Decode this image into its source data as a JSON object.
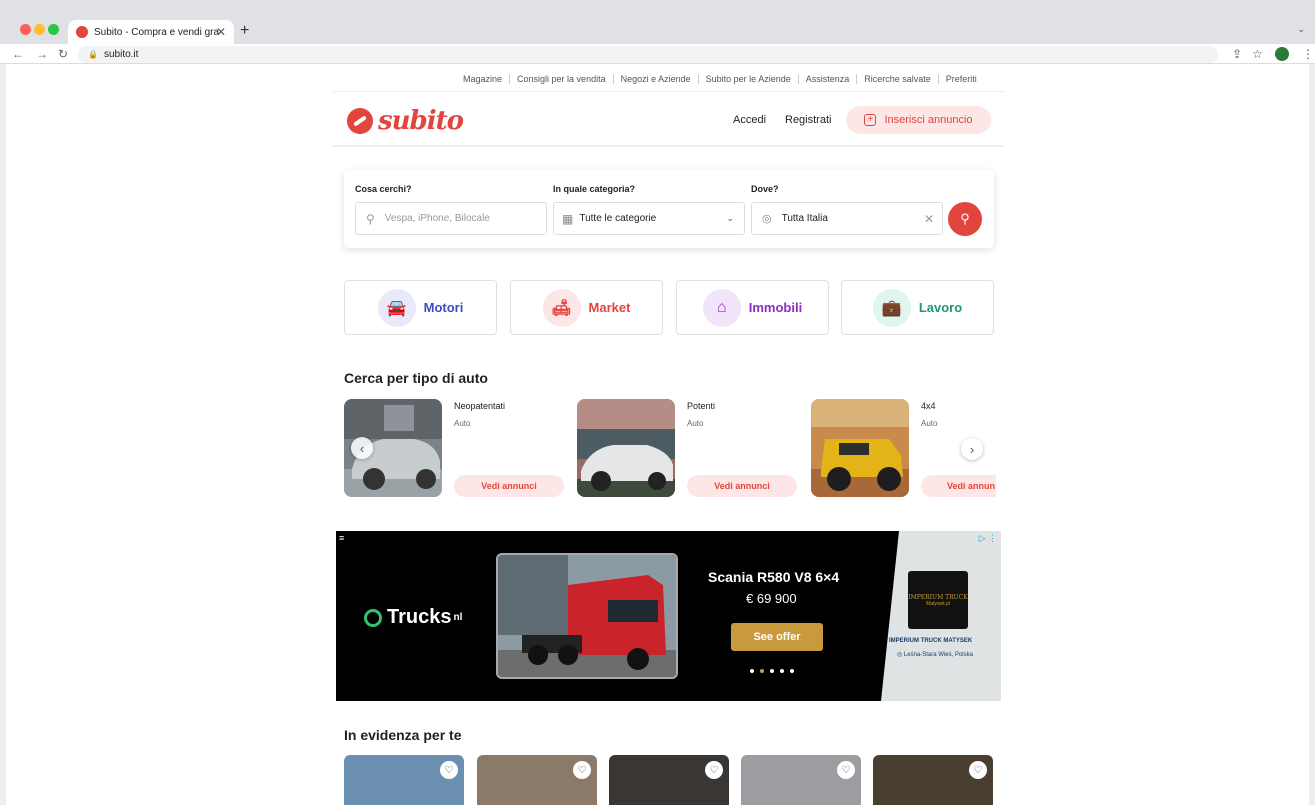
{
  "browser": {
    "tab_title": "Subito - Compra e vendi gra",
    "url": "subito.it"
  },
  "top_links": [
    "Magazine",
    "Consigli per la vendita",
    "Negozi e Aziende",
    "Subito per le Aziende",
    "Assistenza",
    "Ricerche salvate",
    "Preferiti"
  ],
  "header": {
    "logo": "subito",
    "login": "Accedi",
    "register": "Registrati",
    "insert": "Inserisci annuncio"
  },
  "search": {
    "what_label": "Cosa cerchi?",
    "what_placeholder": "Vespa, iPhone, Bilocale",
    "category_label": "In quale categoria?",
    "category_value": "Tutte le categorie",
    "where_label": "Dove?",
    "where_value": "Tutta Italia"
  },
  "categories": [
    {
      "label": "Motori",
      "color": "#3c4cc4",
      "bg": "#e8eafb"
    },
    {
      "label": "Market",
      "color": "#e2453d",
      "bg": "#fde7e6"
    },
    {
      "label": "Immobili",
      "color": "#8e2bc4",
      "bg": "#f2e5fb"
    },
    {
      "label": "Lavoro",
      "color": "#1a9a7a",
      "bg": "#e0f5ef"
    }
  ],
  "car_section": {
    "title": "Cerca per tipo di auto",
    "items": [
      {
        "title": "Neopatentati",
        "subtitle": "Auto",
        "cta": "Vedi annunci"
      },
      {
        "title": "Potenti",
        "subtitle": "Auto",
        "cta": "Vedi annunci"
      },
      {
        "title": "4x4",
        "subtitle": "Auto",
        "cta": "Vedi annun"
      }
    ]
  },
  "ad": {
    "brand": "Trucks",
    "brand_sup": "nl",
    "headline": "Scania R580 V8 6×4",
    "price": "€ 69 900",
    "cta": "See offer",
    "dealer_logo": "IMPERIUM TRUCK",
    "dealer_logo_sub": "Matysek.pl",
    "dealer_name": "IMPERIUM TRUCK MATYSEK",
    "dealer_location": "Leśna-Stara Wieś, Polska"
  },
  "featured": {
    "title": "In evidenza per te"
  }
}
